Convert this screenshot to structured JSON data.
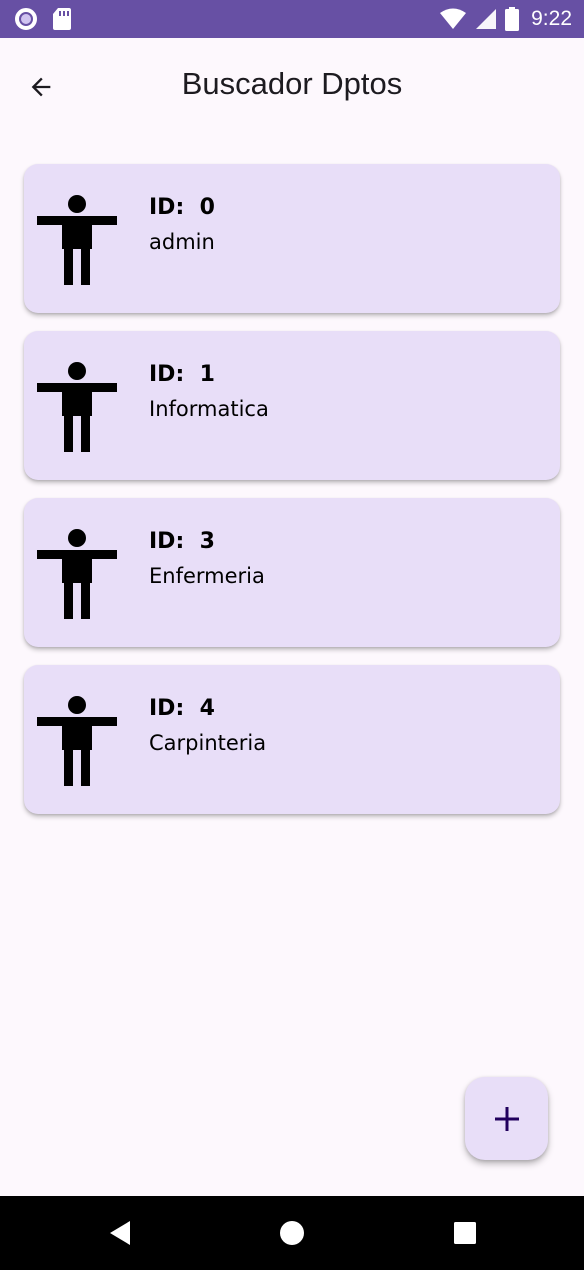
{
  "status_bar": {
    "time": "9:22",
    "icons": [
      "circle-notification-icon",
      "sd-card-icon",
      "wifi-icon",
      "signal-icon",
      "battery-icon"
    ]
  },
  "app_bar": {
    "title": "Buscador Dptos",
    "back_icon": "arrow-back-icon"
  },
  "departments": [
    {
      "id_label": "ID:",
      "id": "0",
      "name": "admin"
    },
    {
      "id_label": "ID:",
      "id": "1",
      "name": "Informatica"
    },
    {
      "id_label": "ID:",
      "id": "3",
      "name": "Enfermeria"
    },
    {
      "id_label": "ID:",
      "id": "4",
      "name": "Carpinteria"
    }
  ],
  "fab": {
    "icon": "plus-icon"
  },
  "nav_bar": {
    "icons": [
      "back-triangle-icon",
      "home-circle-icon",
      "recents-square-icon"
    ]
  },
  "colors": {
    "status_bar": "#6750a4",
    "background": "#fdf8fd",
    "card": "#e8def8",
    "fab_icon": "#21005d"
  }
}
